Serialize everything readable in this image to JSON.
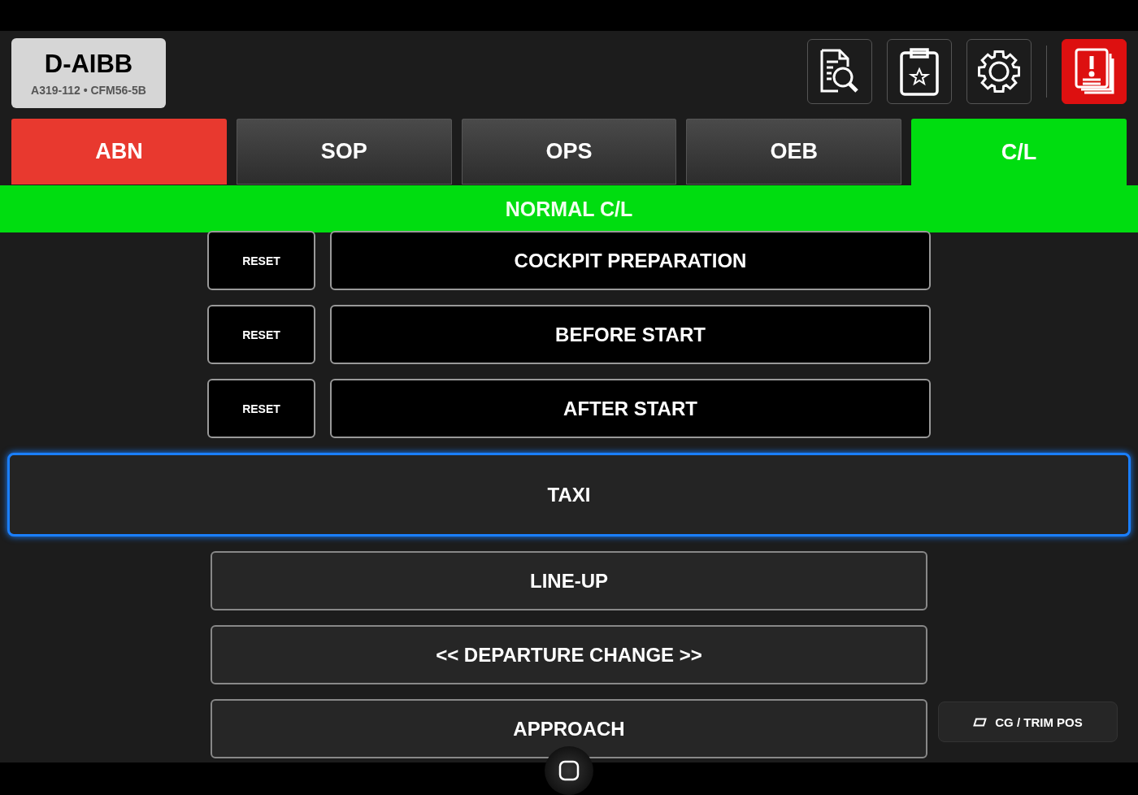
{
  "aircraft": {
    "registration": "D-AIBB",
    "type": "A319-112 • CFM56-5B"
  },
  "tabs": [
    {
      "label": "ABN",
      "kind": "alert",
      "selected": false
    },
    {
      "label": "SOP",
      "kind": "normal",
      "selected": false
    },
    {
      "label": "OPS",
      "kind": "normal",
      "selected": false
    },
    {
      "label": "OEB",
      "kind": "normal",
      "selected": false
    },
    {
      "label": "C/L",
      "kind": "normal",
      "selected": true
    }
  ],
  "section_title": "NORMAL C/L",
  "checklists": [
    {
      "label": "COCKPIT PREPARATION",
      "completed": true,
      "reset": "RESET",
      "selected": false
    },
    {
      "label": "BEFORE START",
      "completed": true,
      "reset": "RESET",
      "selected": false
    },
    {
      "label": "AFTER START",
      "completed": true,
      "reset": "RESET",
      "selected": false
    },
    {
      "label": "TAXI",
      "completed": false,
      "selected": true
    },
    {
      "label": "LINE-UP",
      "completed": false,
      "selected": false
    },
    {
      "label": "<< DEPARTURE CHANGE >>",
      "completed": false,
      "selected": false
    },
    {
      "label": "APPROACH",
      "completed": false,
      "selected": false
    }
  ],
  "cg_button": "CG / TRIM POS"
}
